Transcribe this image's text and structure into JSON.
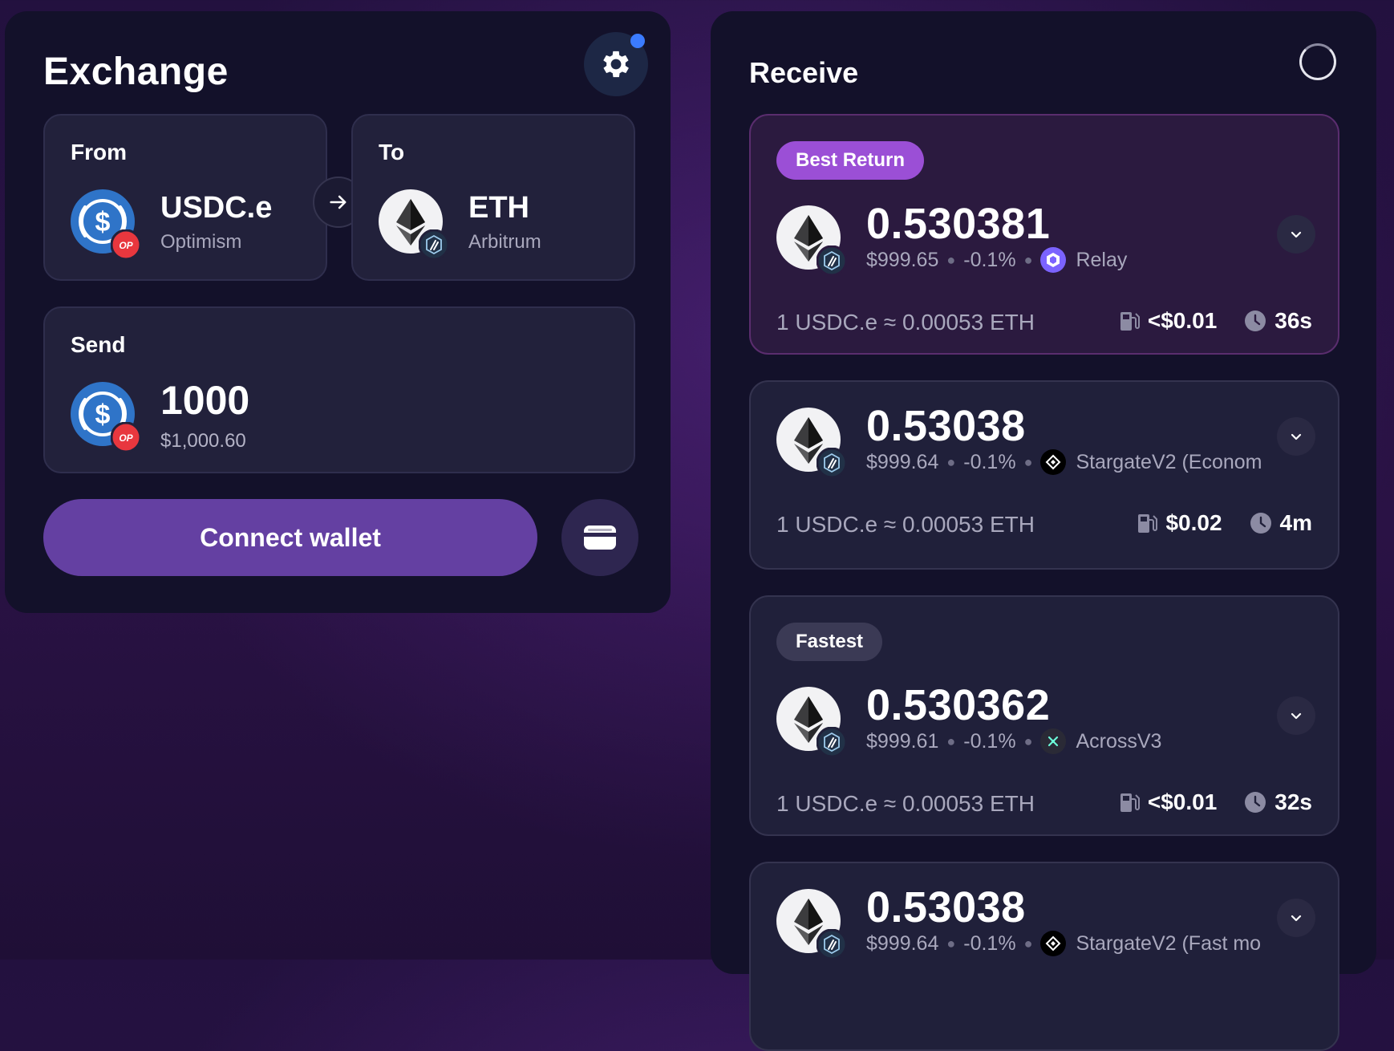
{
  "exchange": {
    "title": "Exchange",
    "from": {
      "label": "From",
      "token": "USDC.e",
      "chain": "Optimism"
    },
    "to": {
      "label": "To",
      "token": "ETH",
      "chain": "Arbitrum"
    },
    "send": {
      "label": "Send",
      "amount": "1000",
      "usd": "$1,000.60"
    },
    "connect_label": "Connect wallet"
  },
  "receive": {
    "title": "Receive",
    "quotes": [
      {
        "badge": "Best Return",
        "amount": "0.530381",
        "usd": "$999.65",
        "change": "-0.1%",
        "provider": "Relay",
        "rate": "1 USDC.e ≈ 0.00053 ETH",
        "gas": "<$0.01",
        "time": "36s"
      },
      {
        "badge": "",
        "amount": "0.53038",
        "usd": "$999.64",
        "change": "-0.1%",
        "provider": "StargateV2 (Econom",
        "rate": "1 USDC.e ≈ 0.00053 ETH",
        "gas": "$0.02",
        "time": "4m"
      },
      {
        "badge": "Fastest",
        "amount": "0.530362",
        "usd": "$999.61",
        "change": "-0.1%",
        "provider": "AcrossV3",
        "rate": "1 USDC.e ≈ 0.00053 ETH",
        "gas": "<$0.01",
        "time": "32s"
      },
      {
        "badge": "",
        "amount": "0.53038",
        "usd": "$999.64",
        "change": "-0.1%",
        "provider": "StargateV2 (Fast mo",
        "rate": "",
        "gas": "",
        "time": ""
      }
    ]
  },
  "colors": {
    "accent": "#6440a2",
    "badge_best": "#9b4fd6",
    "usdc": "#2f74c8",
    "op_red": "#e8373e"
  },
  "icons": [
    "gear-icon",
    "arrow-right-icon",
    "wallet-icon",
    "chevron-down-icon",
    "gas-pump-icon",
    "clock-icon",
    "loading-spinner-icon"
  ]
}
